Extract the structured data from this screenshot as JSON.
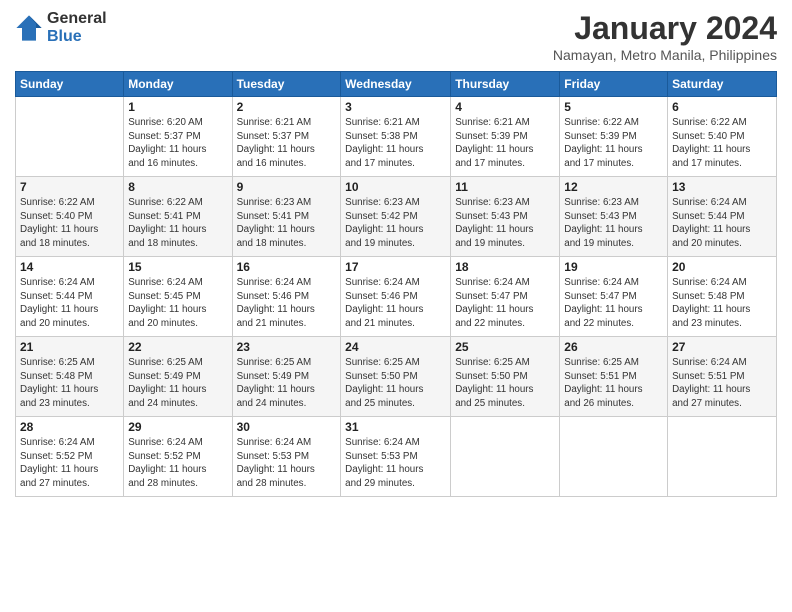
{
  "header": {
    "logo_general": "General",
    "logo_blue": "Blue",
    "month_title": "January 2024",
    "location": "Namayan, Metro Manila, Philippines"
  },
  "calendar": {
    "days_of_week": [
      "Sunday",
      "Monday",
      "Tuesday",
      "Wednesday",
      "Thursday",
      "Friday",
      "Saturday"
    ],
    "weeks": [
      [
        {
          "day": "",
          "info": ""
        },
        {
          "day": "1",
          "info": "Sunrise: 6:20 AM\nSunset: 5:37 PM\nDaylight: 11 hours\nand 16 minutes."
        },
        {
          "day": "2",
          "info": "Sunrise: 6:21 AM\nSunset: 5:37 PM\nDaylight: 11 hours\nand 16 minutes."
        },
        {
          "day": "3",
          "info": "Sunrise: 6:21 AM\nSunset: 5:38 PM\nDaylight: 11 hours\nand 17 minutes."
        },
        {
          "day": "4",
          "info": "Sunrise: 6:21 AM\nSunset: 5:39 PM\nDaylight: 11 hours\nand 17 minutes."
        },
        {
          "day": "5",
          "info": "Sunrise: 6:22 AM\nSunset: 5:39 PM\nDaylight: 11 hours\nand 17 minutes."
        },
        {
          "day": "6",
          "info": "Sunrise: 6:22 AM\nSunset: 5:40 PM\nDaylight: 11 hours\nand 17 minutes."
        }
      ],
      [
        {
          "day": "7",
          "info": "Sunrise: 6:22 AM\nSunset: 5:40 PM\nDaylight: 11 hours\nand 18 minutes."
        },
        {
          "day": "8",
          "info": "Sunrise: 6:22 AM\nSunset: 5:41 PM\nDaylight: 11 hours\nand 18 minutes."
        },
        {
          "day": "9",
          "info": "Sunrise: 6:23 AM\nSunset: 5:41 PM\nDaylight: 11 hours\nand 18 minutes."
        },
        {
          "day": "10",
          "info": "Sunrise: 6:23 AM\nSunset: 5:42 PM\nDaylight: 11 hours\nand 19 minutes."
        },
        {
          "day": "11",
          "info": "Sunrise: 6:23 AM\nSunset: 5:43 PM\nDaylight: 11 hours\nand 19 minutes."
        },
        {
          "day": "12",
          "info": "Sunrise: 6:23 AM\nSunset: 5:43 PM\nDaylight: 11 hours\nand 19 minutes."
        },
        {
          "day": "13",
          "info": "Sunrise: 6:24 AM\nSunset: 5:44 PM\nDaylight: 11 hours\nand 20 minutes."
        }
      ],
      [
        {
          "day": "14",
          "info": "Sunrise: 6:24 AM\nSunset: 5:44 PM\nDaylight: 11 hours\nand 20 minutes."
        },
        {
          "day": "15",
          "info": "Sunrise: 6:24 AM\nSunset: 5:45 PM\nDaylight: 11 hours\nand 20 minutes."
        },
        {
          "day": "16",
          "info": "Sunrise: 6:24 AM\nSunset: 5:46 PM\nDaylight: 11 hours\nand 21 minutes."
        },
        {
          "day": "17",
          "info": "Sunrise: 6:24 AM\nSunset: 5:46 PM\nDaylight: 11 hours\nand 21 minutes."
        },
        {
          "day": "18",
          "info": "Sunrise: 6:24 AM\nSunset: 5:47 PM\nDaylight: 11 hours\nand 22 minutes."
        },
        {
          "day": "19",
          "info": "Sunrise: 6:24 AM\nSunset: 5:47 PM\nDaylight: 11 hours\nand 22 minutes."
        },
        {
          "day": "20",
          "info": "Sunrise: 6:24 AM\nSunset: 5:48 PM\nDaylight: 11 hours\nand 23 minutes."
        }
      ],
      [
        {
          "day": "21",
          "info": "Sunrise: 6:25 AM\nSunset: 5:48 PM\nDaylight: 11 hours\nand 23 minutes."
        },
        {
          "day": "22",
          "info": "Sunrise: 6:25 AM\nSunset: 5:49 PM\nDaylight: 11 hours\nand 24 minutes."
        },
        {
          "day": "23",
          "info": "Sunrise: 6:25 AM\nSunset: 5:49 PM\nDaylight: 11 hours\nand 24 minutes."
        },
        {
          "day": "24",
          "info": "Sunrise: 6:25 AM\nSunset: 5:50 PM\nDaylight: 11 hours\nand 25 minutes."
        },
        {
          "day": "25",
          "info": "Sunrise: 6:25 AM\nSunset: 5:50 PM\nDaylight: 11 hours\nand 25 minutes."
        },
        {
          "day": "26",
          "info": "Sunrise: 6:25 AM\nSunset: 5:51 PM\nDaylight: 11 hours\nand 26 minutes."
        },
        {
          "day": "27",
          "info": "Sunrise: 6:24 AM\nSunset: 5:51 PM\nDaylight: 11 hours\nand 27 minutes."
        }
      ],
      [
        {
          "day": "28",
          "info": "Sunrise: 6:24 AM\nSunset: 5:52 PM\nDaylight: 11 hours\nand 27 minutes."
        },
        {
          "day": "29",
          "info": "Sunrise: 6:24 AM\nSunset: 5:52 PM\nDaylight: 11 hours\nand 28 minutes."
        },
        {
          "day": "30",
          "info": "Sunrise: 6:24 AM\nSunset: 5:53 PM\nDaylight: 11 hours\nand 28 minutes."
        },
        {
          "day": "31",
          "info": "Sunrise: 6:24 AM\nSunset: 5:53 PM\nDaylight: 11 hours\nand 29 minutes."
        },
        {
          "day": "",
          "info": ""
        },
        {
          "day": "",
          "info": ""
        },
        {
          "day": "",
          "info": ""
        }
      ]
    ]
  }
}
